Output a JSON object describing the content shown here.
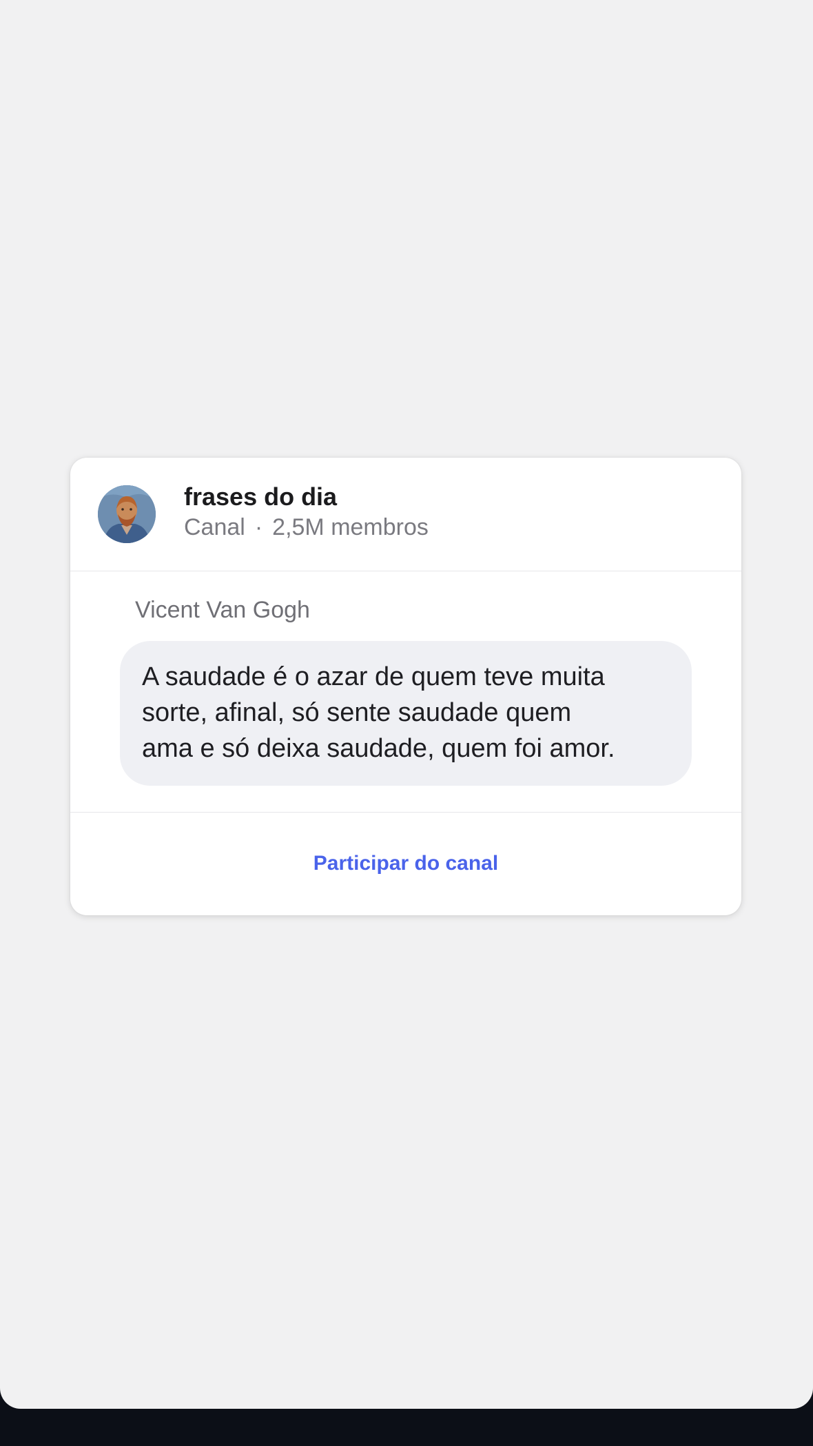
{
  "channel": {
    "name": "frases do dia",
    "type": "Canal",
    "separator": "·",
    "members": "2,5M membros",
    "avatar_icon": "van-gogh-portrait-avatar"
  },
  "message": {
    "author": "Vicent Van Gogh",
    "text": "A saudade é o azar de quem teve muita\nsorte, afinal, só sente saudade quem\nama e só deixa saudade, quem foi amor."
  },
  "footer": {
    "join_label": "Participar do canal"
  },
  "colors": {
    "background": "#f1f1f2",
    "card": "#ffffff",
    "bubble": "#eff0f4",
    "accent": "#4a63ea",
    "bottom_bar": "#0c0f17"
  }
}
